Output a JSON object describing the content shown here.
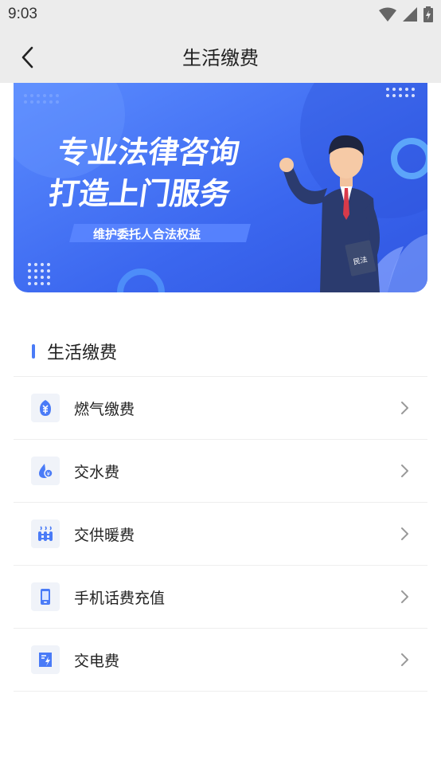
{
  "status_bar": {
    "time": "9:03"
  },
  "nav": {
    "title": "生活缴费"
  },
  "banner": {
    "line1": "专业法律咨询",
    "line2": "打造上门服务",
    "tagline": "维护委托人合法权益",
    "book_label": "民法"
  },
  "section": {
    "title": "生活缴费"
  },
  "items": [
    {
      "label": "燃气缴费",
      "icon": "gas-yuan-icon"
    },
    {
      "label": "交水费",
      "icon": "water-drop-icon"
    },
    {
      "label": "交供暖费",
      "icon": "heater-icon"
    },
    {
      "label": "手机话费充值",
      "icon": "phone-icon"
    },
    {
      "label": "交电费",
      "icon": "electric-bill-icon"
    }
  ],
  "colors": {
    "accent": "#4a7bf7",
    "banner_bg": "#3f6ef0",
    "nav_bg": "#ececec"
  }
}
